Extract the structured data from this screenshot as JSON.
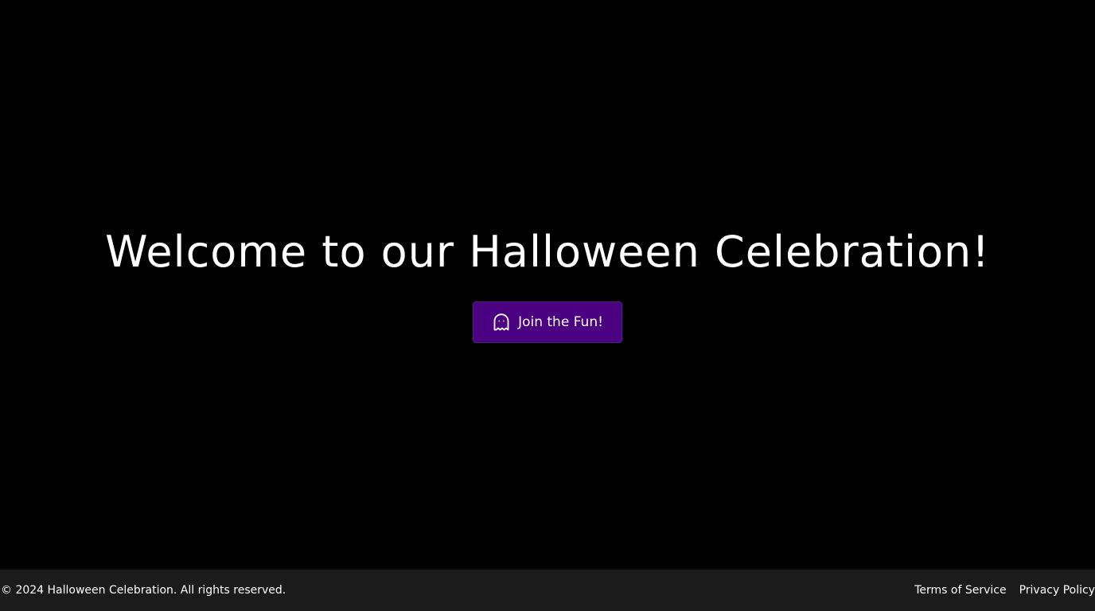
{
  "hero": {
    "title": "Welcome to our Halloween Celebration!",
    "cta": {
      "label": "Join the Fun!",
      "icon": "ghost-icon"
    }
  },
  "footer": {
    "copyright": "© 2024 Halloween Celebration. All rights reserved.",
    "links": [
      {
        "label": "Terms of Service"
      },
      {
        "label": "Privacy Policy"
      }
    ]
  },
  "colors": {
    "background": "#000000",
    "accent": "#4b0082",
    "footer_background": "#1b1b1b",
    "text": "#ffffff"
  }
}
